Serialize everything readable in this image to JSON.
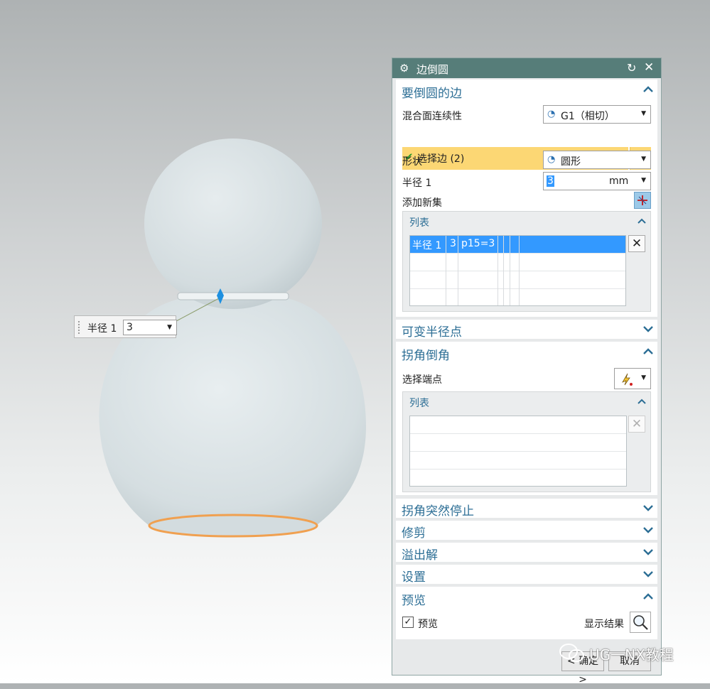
{
  "viewport": {
    "callout": {
      "label": "半径 1",
      "value": "3"
    }
  },
  "dialog": {
    "title": "边倒圆",
    "sections": {
      "edge": {
        "title": "要倒圆的边",
        "continuity_label": "混合面连续性",
        "continuity_value": "G1（相切）",
        "select_label": "选择边 (2)",
        "shape_label": "形状",
        "shape_value": "圆形",
        "radius_label": "半径 1",
        "radius_value": "3",
        "radius_unit": "mm",
        "add_set_label": "添加新集",
        "list_title": "列表",
        "list_rows": [
          {
            "name": "半径 1",
            "value": "3",
            "expr": "p15=3"
          }
        ]
      },
      "variable": {
        "title": "可变半径点"
      },
      "corner": {
        "title": "拐角倒角",
        "select_endpoint_label": "选择端点",
        "list_title": "列表"
      },
      "corner_stop": {
        "title": "拐角突然停止"
      },
      "trim": {
        "title": "修剪"
      },
      "overflow": {
        "title": "溢出解"
      },
      "settings": {
        "title": "设置"
      },
      "preview": {
        "title": "预览",
        "preview_check_label": "预览",
        "preview_checked": true,
        "show_result_label": "显示结果"
      }
    },
    "buttons": {
      "ok": "< 确定 >",
      "cancel": "取消"
    }
  },
  "watermark": "UG一NX教程",
  "colors": {
    "titlebar": "#567d79",
    "section_title": "#2c6e95",
    "selection_highlight": "#fcd774",
    "list_selected": "#3399ff",
    "edge_highlight": "#f0a050"
  }
}
